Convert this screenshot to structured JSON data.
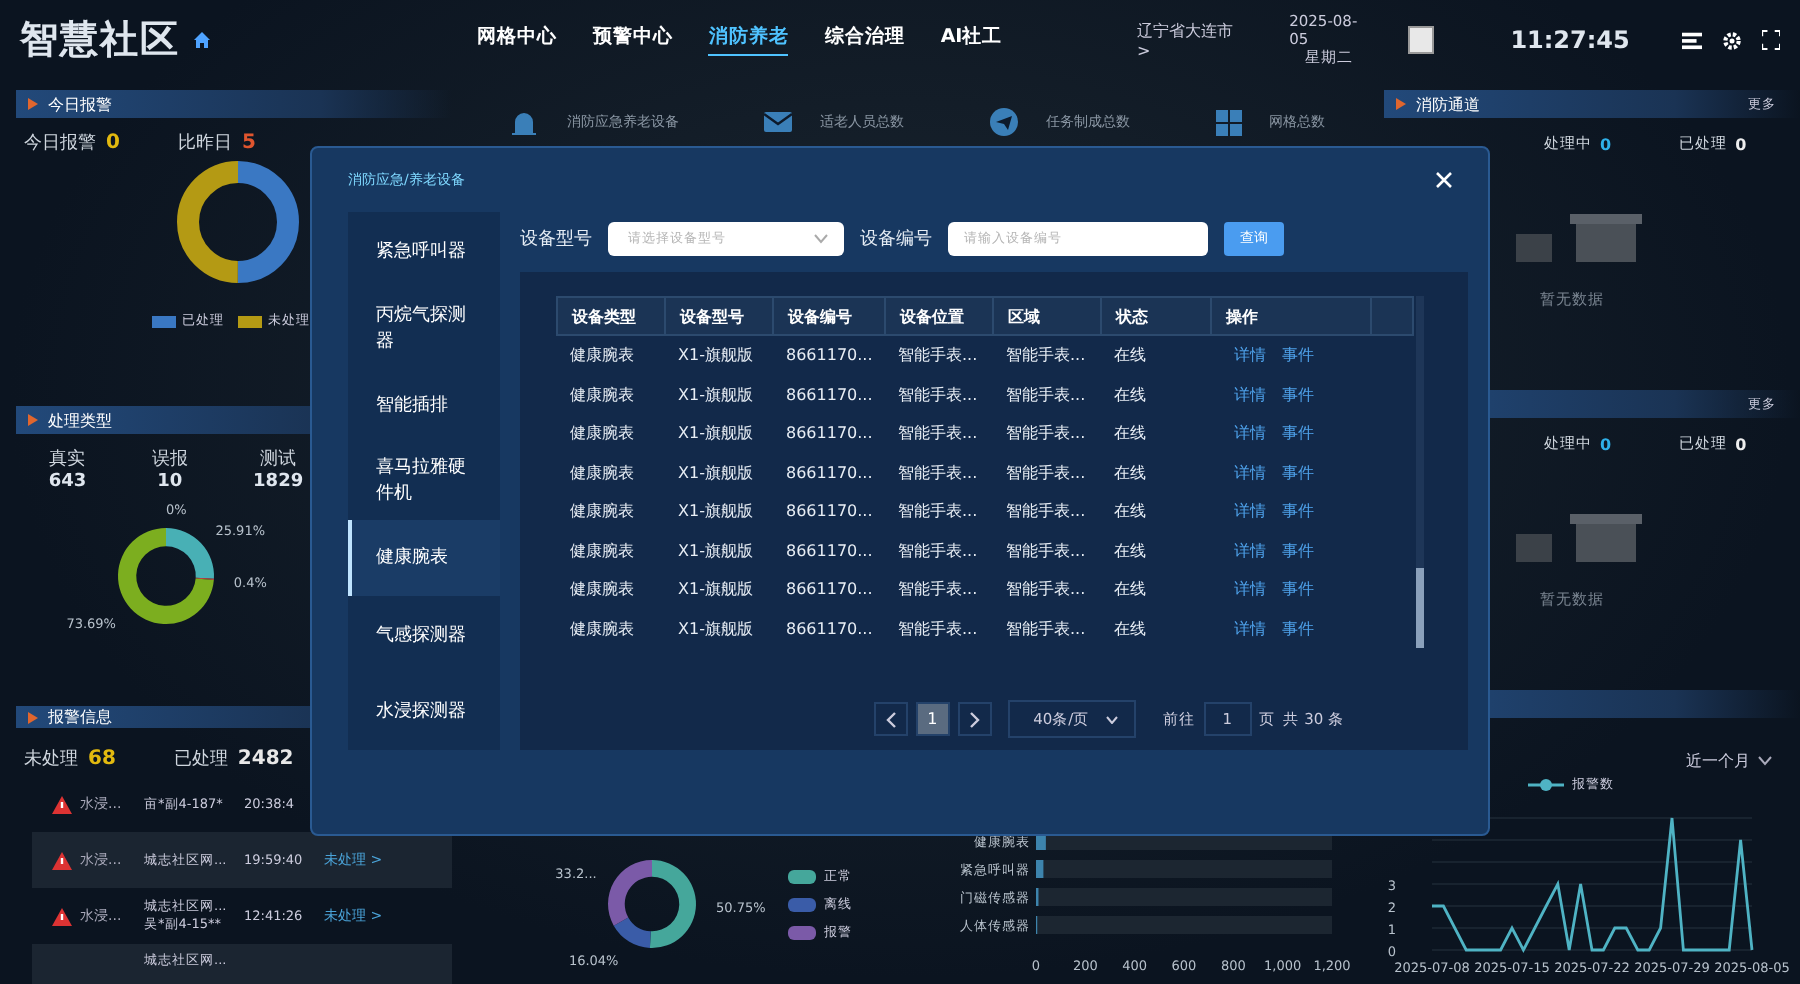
{
  "header": {
    "title": "智慧社区",
    "nav": [
      {
        "label": "网格中心",
        "selected": false
      },
      {
        "label": "预警中心",
        "selected": false
      },
      {
        "label": "消防养老",
        "selected": true
      },
      {
        "label": "综合治理",
        "selected": false
      },
      {
        "label": "AI社工",
        "selected": false
      }
    ],
    "location": "辽宁省大连市 >",
    "date": "2025-08-05",
    "weekday": "星期二",
    "time": "11:27:45"
  },
  "today_alarm": {
    "title": "今日报警",
    "today_label": "今日报警",
    "today_value": "0",
    "compare_label": "比昨日",
    "compare_value": "5",
    "legend": [
      {
        "label": "已处理",
        "color": "#3a78c3"
      },
      {
        "label": "未处理",
        "color": "#b49a14"
      }
    ]
  },
  "handle_type": {
    "title": "处理类型",
    "stats": [
      {
        "label": "真实",
        "value": "643"
      },
      {
        "label": "误报",
        "value": "10"
      },
      {
        "label": "测试",
        "value": "1829"
      }
    ],
    "chart_data": {
      "type": "donut",
      "values": [
        0,
        25.91,
        0.4,
        73.69
      ],
      "value_labels": [
        "0%",
        "25.91%",
        "0.4%",
        "73.69%"
      ]
    }
  },
  "alarm_info": {
    "title": "报警信息",
    "unhandled_label": "未处理",
    "unhandled_value": "68",
    "handled_label": "已处理",
    "handled_value": "2482",
    "rows": [
      {
        "type": "水浸...",
        "location": [
          "亩*副4-187*"
        ],
        "time": "20:38:4"
      },
      {
        "type": "水浸...",
        "location": [
          "城志社区网..."
        ],
        "time": "19:59:40",
        "action": "未处理 >"
      },
      {
        "type": "水浸...",
        "location": [
          "城志社区网...",
          "吴*副4-15**"
        ],
        "time": "12:41:26",
        "action": "未处理 >"
      },
      {
        "location": [
          "城志社区网..."
        ]
      }
    ]
  },
  "center": {
    "stats": [
      {
        "kind": "siren",
        "label": "消防应急养老设备"
      },
      {
        "kind": "mail",
        "label": "适老人员总数"
      },
      {
        "kind": "send",
        "label": "任务制成总数"
      },
      {
        "kind": "grid",
        "label": "网格总数"
      }
    ],
    "status_chart": {
      "chart_data": {
        "type": "donut",
        "categories": [
          "正常",
          "离线",
          "报警"
        ],
        "values": [
          50.75,
          16.04,
          33.21
        ],
        "value_labels": [
          "50.75%",
          "16.04%",
          "33.2..."
        ]
      }
    },
    "device_chart": {
      "chart_data": {
        "type": "bar",
        "orientation": "horizontal",
        "categories": [
          "健康腕表",
          "紧急呼叫器",
          "门磁传感器",
          "人体传感器"
        ],
        "values": [
          40,
          30,
          10,
          5
        ],
        "xlim": [
          0,
          1200
        ],
        "xticks": [
          0,
          200,
          400,
          600,
          800,
          {
            "value": 1000,
            "label": "1,000"
          },
          {
            "value": 1200,
            "label": "1,200"
          }
        ]
      }
    }
  },
  "right": {
    "panels": [
      {
        "title": "消防通道",
        "more": "更多",
        "processing_label": "处理中",
        "processing_value": "0",
        "done_label": "已处理",
        "done_value": "0",
        "empty": "暂无数据"
      },
      {
        "more": "更多",
        "processing_label": "处理中",
        "processing_value": "0",
        "done_label": "已处理",
        "done_value": "0",
        "empty": "暂无数据"
      }
    ],
    "trend": {
      "range": "近一个月",
      "chart_data": {
        "type": "line",
        "x": [
          "2025-07-08",
          "2025-07-09",
          "2025-07-10",
          "2025-07-11",
          "2025-07-12",
          "2025-07-13",
          "2025-07-14",
          "2025-07-15",
          "2025-07-16",
          "2025-07-17",
          "2025-07-18",
          "2025-07-19",
          "2025-07-20",
          "2025-07-21",
          "2025-07-22",
          "2025-07-23",
          "2025-07-24",
          "2025-07-25",
          "2025-07-26",
          "2025-07-27",
          "2025-07-28",
          "2025-07-29",
          "2025-07-30",
          "2025-07-31",
          "2025-08-01",
          "2025-08-02",
          "2025-08-03",
          "2025-08-04",
          "2025-08-05"
        ],
        "series": [
          {
            "name": "报警数",
            "color": "#4fb3c4",
            "values": [
              2,
              2,
              1,
              0,
              0,
              0,
              0,
              1,
              0,
              1,
              2,
              3,
              0,
              3,
              0,
              0,
              1,
              1,
              0,
              0,
              1,
              6,
              0,
              0,
              0,
              0,
              0,
              5,
              0
            ]
          }
        ],
        "xticks": [
          "2025-07-08",
          "2025-07-15",
          "2025-07-22",
          "2025-07-29",
          "2025-08-05"
        ],
        "xlim": [
          "2025-07-08",
          "2025-08-05"
        ],
        "ylim": [
          0,
          6
        ],
        "yticks": [
          0,
          1,
          2,
          3
        ],
        "grid": true
      }
    }
  },
  "modal": {
    "title": "消防应急/养老设备",
    "categories": [
      {
        "label": "紧急呼叫器",
        "selected": false
      },
      {
        "label": "丙烷气探测器",
        "selected": false
      },
      {
        "label": "智能插排",
        "selected": false
      },
      {
        "label": "喜马拉雅硬件机",
        "selected": false
      },
      {
        "label": "健康腕表",
        "selected": true
      },
      {
        "label": "气感探测器",
        "selected": false
      },
      {
        "label": "水浸探测器",
        "selected": false
      }
    ],
    "filters": {
      "model_label": "设备型号",
      "model_placeholder": "请选择设备型号",
      "number_label": "设备编号",
      "number_placeholder": "请输入设备编号",
      "query": "查询"
    },
    "table": {
      "columns": [
        "设备类型",
        "设备型号",
        "设备编号",
        "设备位置",
        "区域",
        "状态",
        "操作"
      ],
      "rows": [
        [
          "健康腕表",
          "X1-旗舰版",
          "8661170...",
          "智能手表...",
          "智能手表...",
          "在线",
          [
            "详情",
            "事件"
          ]
        ],
        [
          "健康腕表",
          "X1-旗舰版",
          "8661170...",
          "智能手表...",
          "智能手表...",
          "在线",
          [
            "详情",
            "事件"
          ]
        ],
        [
          "健康腕表",
          "X1-旗舰版",
          "8661170...",
          "智能手表...",
          "智能手表...",
          "在线",
          [
            "详情",
            "事件"
          ]
        ],
        [
          "健康腕表",
          "X1-旗舰版",
          "8661170...",
          "智能手表...",
          "智能手表...",
          "在线",
          [
            "详情",
            "事件"
          ]
        ],
        [
          "健康腕表",
          "X1-旗舰版",
          "8661170...",
          "智能手表...",
          "智能手表...",
          "在线",
          [
            "详情",
            "事件"
          ]
        ],
        [
          "健康腕表",
          "X1-旗舰版",
          "8661170...",
          "智能手表...",
          "智能手表...",
          "在线",
          [
            "详情",
            "事件"
          ]
        ],
        [
          "健康腕表",
          "X1-旗舰版",
          "8661170...",
          "智能手表...",
          "智能手表...",
          "在线",
          [
            "详情",
            "事件"
          ]
        ],
        [
          "健康腕表",
          "X1-旗舰版",
          "8661170...",
          "智能手表...",
          "智能手表...",
          "在线",
          [
            "详情",
            "事件"
          ]
        ]
      ]
    },
    "pagination": {
      "pages": [
        {
          "label": "1",
          "selected": true
        }
      ],
      "page_size": "40条/页",
      "goto_label": "前往",
      "goto_value": "1",
      "page_unit": "页",
      "total": "共 30 条"
    }
  }
}
